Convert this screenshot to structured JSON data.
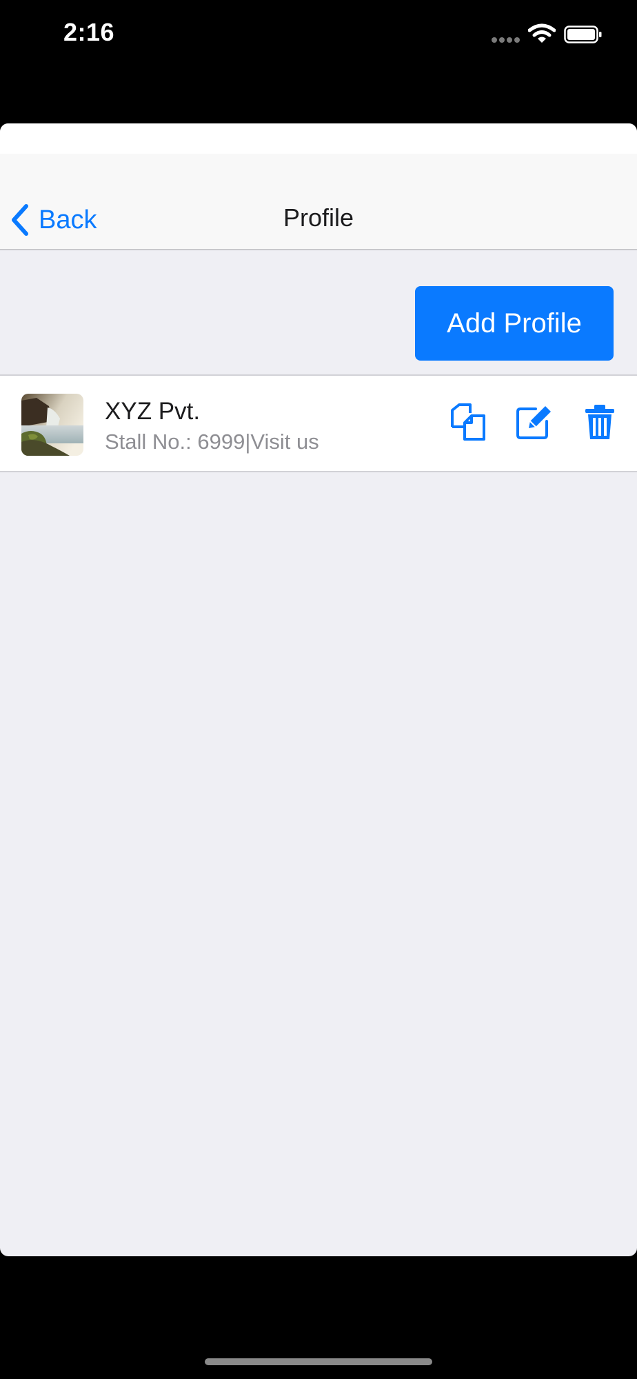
{
  "status_bar": {
    "time": "2:16",
    "wifi_icon": "wifi-icon",
    "battery_icon": "battery-icon"
  },
  "nav": {
    "back_label": "Back",
    "back_icon": "chevron-left-icon",
    "title": "Profile"
  },
  "add_profile_label": "Add Profile",
  "profiles": [
    {
      "name": "XYZ Pvt.",
      "subtitle": "Stall No.: 6999|Visit us",
      "thumbnail": "waterfall-landscape-photo",
      "actions": [
        "copy-icon",
        "edit-icon",
        "delete-icon"
      ]
    }
  ],
  "colors": {
    "accent": "#0a7aff",
    "background": "#efeff4",
    "nav_background": "#f8f8f8",
    "subtitle": "#8e8e93"
  }
}
